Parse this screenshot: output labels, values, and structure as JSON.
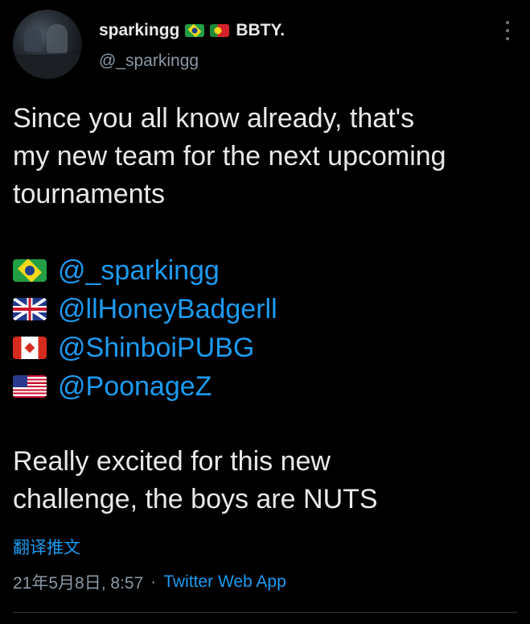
{
  "tweet": {
    "author": {
      "display_name": "sparkingg",
      "flags": [
        "brazil-flag",
        "portugal-flag"
      ],
      "team_suffix": "BBTY.",
      "handle": "@_sparkingg"
    },
    "text_lines": [
      "Since you all know already, that's",
      "my new team for the next upcoming",
      "tournaments"
    ],
    "mentions": [
      {
        "flag": "brazil-flag",
        "handle": "@_sparkingg"
      },
      {
        "flag": "united-kingdom-flag",
        "handle": "@llHoneyBadgerll"
      },
      {
        "flag": "canada-flag",
        "handle": "@ShinboiPUBG"
      },
      {
        "flag": "united-states-flag",
        "handle": "@PoonageZ"
      }
    ],
    "closing_lines": [
      "Really excited for this new",
      "challenge, the boys are NUTS"
    ],
    "translate_label": "翻译推文",
    "timestamp": "21年5月8日, 8:57",
    "separator": "·",
    "source": "Twitter Web App"
  },
  "icons": {
    "more": "more-vertical-icon"
  },
  "colors": {
    "background": "#000000",
    "text": "#e7e9ea",
    "secondary": "#8b98a5",
    "link": "#1d9bf0"
  }
}
